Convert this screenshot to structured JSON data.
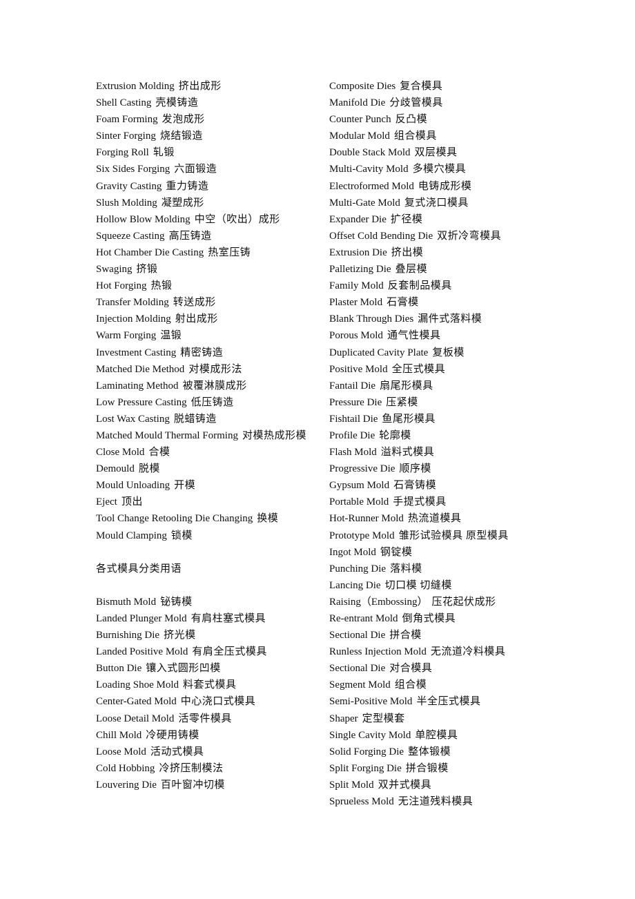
{
  "left_column": {
    "terms_top": [
      [
        "Extrusion Molding",
        "挤出成形"
      ],
      [
        "Shell Casting",
        "壳模铸造"
      ],
      [
        "Foam Forming",
        "发泡成形"
      ],
      [
        "Sinter Forging",
        "烧结锻造"
      ],
      [
        "Forging Roll",
        "轧锻"
      ],
      [
        "Six Sides Forging",
        "六面锻造"
      ],
      [
        "Gravity Casting",
        "重力铸造"
      ],
      [
        "Slush Molding",
        "凝塑成形"
      ],
      [
        "Hollow Blow Molding",
        "中空（吹出）成形"
      ],
      [
        "Squeeze Casting",
        "高压铸造"
      ],
      [
        "Hot Chamber Die Casting",
        "热室压铸"
      ],
      [
        "Swaging",
        "挤锻"
      ],
      [
        "Hot Forging",
        "热锻"
      ],
      [
        "Transfer Molding",
        "转送成形"
      ],
      [
        "Injection Molding",
        "射出成形"
      ],
      [
        "Warm Forging",
        "温锻"
      ],
      [
        "Investment Casting",
        "精密铸造"
      ],
      [
        "Matched Die Method",
        "对模成形法"
      ],
      [
        "Laminating Method",
        "被覆淋膜成形"
      ],
      [
        "Low Pressure Casting",
        "低压铸造"
      ],
      [
        "Lost Wax Casting",
        "脱蜡铸造"
      ],
      [
        "Matched Mould Thermal Forming",
        "对模热成形模"
      ],
      [
        "Close Mold",
        "合模"
      ],
      [
        "Demould",
        "脱模"
      ],
      [
        "Mould Unloading",
        "开模"
      ],
      [
        "Eject",
        "顶出"
      ],
      [
        "Tool Change Retooling Die Changing",
        "换模"
      ],
      [
        "Mould Clamping",
        "锁模"
      ]
    ],
    "section_heading": "各式模具分类用语",
    "terms_bottom": [
      [
        "Bismuth Mold",
        "铋铸模"
      ],
      [
        "Landed Plunger Mold",
        "有肩柱塞式模具"
      ],
      [
        "Burnishing Die",
        "挤光模"
      ],
      [
        "Landed Positive Mold",
        "有肩全压式模具"
      ],
      [
        "Button Die",
        "镶入式圆形凹模"
      ],
      [
        "Loading Shoe Mold",
        "料套式模具"
      ],
      [
        "Center-Gated Mold",
        "中心浇口式模具"
      ],
      [
        "Loose Detail Mold",
        "活零件模具"
      ],
      [
        "Chill Mold",
        "冷硬用铸模"
      ],
      [
        "Loose Mold",
        "活动式模具"
      ],
      [
        "Cold Hobbing",
        "冷挤压制模法"
      ],
      [
        "Louvering Die",
        "百叶窗冲切模"
      ]
    ]
  },
  "right_column": {
    "terms": [
      [
        "Composite Dies",
        "复合模具"
      ],
      [
        "Manifold Die",
        "分歧管模具"
      ],
      [
        "Counter Punch",
        "反凸模"
      ],
      [
        "Modular Mold",
        "组合模具"
      ],
      [
        "Double Stack Mold",
        "双层模具"
      ],
      [
        "Multi-Cavity Mold",
        "多模穴模具"
      ],
      [
        "Electroformed Mold",
        "电铸成形模"
      ],
      [
        "Multi-Gate Mold",
        "复式浇口模具"
      ],
      [
        "Expander Die",
        "扩径模"
      ],
      [
        "Offset Cold Bending Die",
        "双折冷弯模具"
      ],
      [
        "Extrusion Die",
        "挤出模"
      ],
      [
        "Palletizing Die",
        "叠层模"
      ],
      [
        "Family Mold",
        "反套制品模具"
      ],
      [
        "Plaster Mold",
        "石膏模"
      ],
      [
        "Blank Through Dies",
        "漏件式落料模"
      ],
      [
        "Porous Mold",
        "通气性模具"
      ],
      [
        "Duplicated Cavity Plate",
        "复板模"
      ],
      [
        "Positive Mold",
        "全压式模具"
      ],
      [
        "Fantail Die",
        "扇尾形模具"
      ],
      [
        "Pressure Die",
        "压紧模"
      ],
      [
        "Fishtail Die",
        "鱼尾形模具"
      ],
      [
        "Profile Die",
        "轮廓模"
      ],
      [
        "Flash Mold",
        "溢料式模具"
      ],
      [
        "Progressive Die",
        "顺序模"
      ],
      [
        "Gypsum Mold",
        "石膏铸模"
      ],
      [
        "Portable Mold",
        "手提式模具"
      ],
      [
        "Hot-Runner Mold",
        "热流道模具"
      ],
      [
        "Prototype Mold",
        "雏形试验模具  原型模具"
      ],
      [
        "Ingot Mold",
        "钢锭模"
      ],
      [
        "Punching Die",
        "落料模"
      ],
      [
        "Lancing Die",
        "切口模  切缝模"
      ],
      [
        "Raising（Embossing）",
        "压花起伏成形"
      ],
      [
        "Re-entrant Mold",
        "倒角式模具"
      ],
      [
        "Sectional Die",
        "拼合模"
      ],
      [
        "Runless Injection Mold",
        "无流道冷料模具"
      ],
      [
        "Sectional Die",
        "对合模具"
      ],
      [
        "Segment Mold",
        "组合模"
      ],
      [
        "Semi-Positive Mold",
        "半全压式模具"
      ],
      [
        "Shaper",
        "定型模套"
      ],
      [
        "Single Cavity Mold",
        "单腔模具"
      ],
      [
        "Solid Forging Die",
        "整体锻模"
      ],
      [
        "Split Forging Die",
        "拼合锻模"
      ],
      [
        "Split Mold",
        "双并式模具"
      ],
      [
        "Sprueless Mold",
        "无注道残料模具"
      ]
    ]
  }
}
